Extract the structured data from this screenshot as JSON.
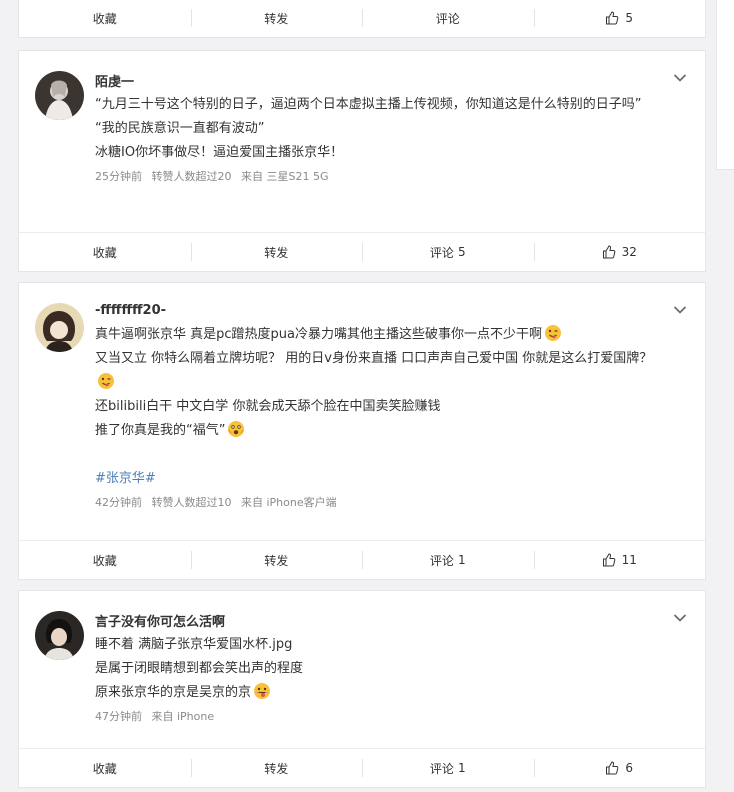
{
  "labels": {
    "collect": "收藏",
    "repost": "转发",
    "comment": "评论"
  },
  "top_bar": {
    "like_count": "5"
  },
  "posts": [
    {
      "username": "陌虔一",
      "lines": [
        "“九月三十号这个特别的日子，逼迫两个日本虚拟主播上传视频，你知道这是什么特别的日子吗”",
        "“我的民族意识一直都有波动”",
        "冰糖IO你坏事做尽！逼迫爱国主播张京华！"
      ],
      "meta": {
        "time": "25分钟前",
        "repost": "转赞人数超过20",
        "source": "来自 三星S21 5G"
      },
      "comment_count": "5",
      "like_count": "32"
    },
    {
      "username": "-ffffffff20-",
      "lines": [
        "真牛逼啊张京华 真是pc蹭热度pua冷暴力嘴其他主播这些破事你一点不少干啊",
        "又当又立 你特么隔着立牌坊呢？ 用的日v身份来直播 口口声声自己爱中国 你就是这么打爱国牌？",
        "还bilibili白干 中文白学 你就会成天舔个脸在中国卖笑脸赚钱",
        "推了你真是我的“福气”"
      ],
      "hashtag": "#张京华#",
      "meta": {
        "time": "42分钟前",
        "repost": "转赞人数超过10",
        "source": "来自 iPhone客户端"
      },
      "comment_count": "1",
      "like_count": "11"
    },
    {
      "username": "言子没有你可怎么活啊",
      "lines": [
        "睡不着 满脑子张京华爱国水杯.jpg",
        "是属于闭眼睛想到都会笑出声的程度",
        "原来张京华的京是吴京的京"
      ],
      "meta": {
        "time": "47分钟前",
        "source": "来自 iPhone"
      },
      "comment_count": "1",
      "like_count": "6"
    }
  ]
}
